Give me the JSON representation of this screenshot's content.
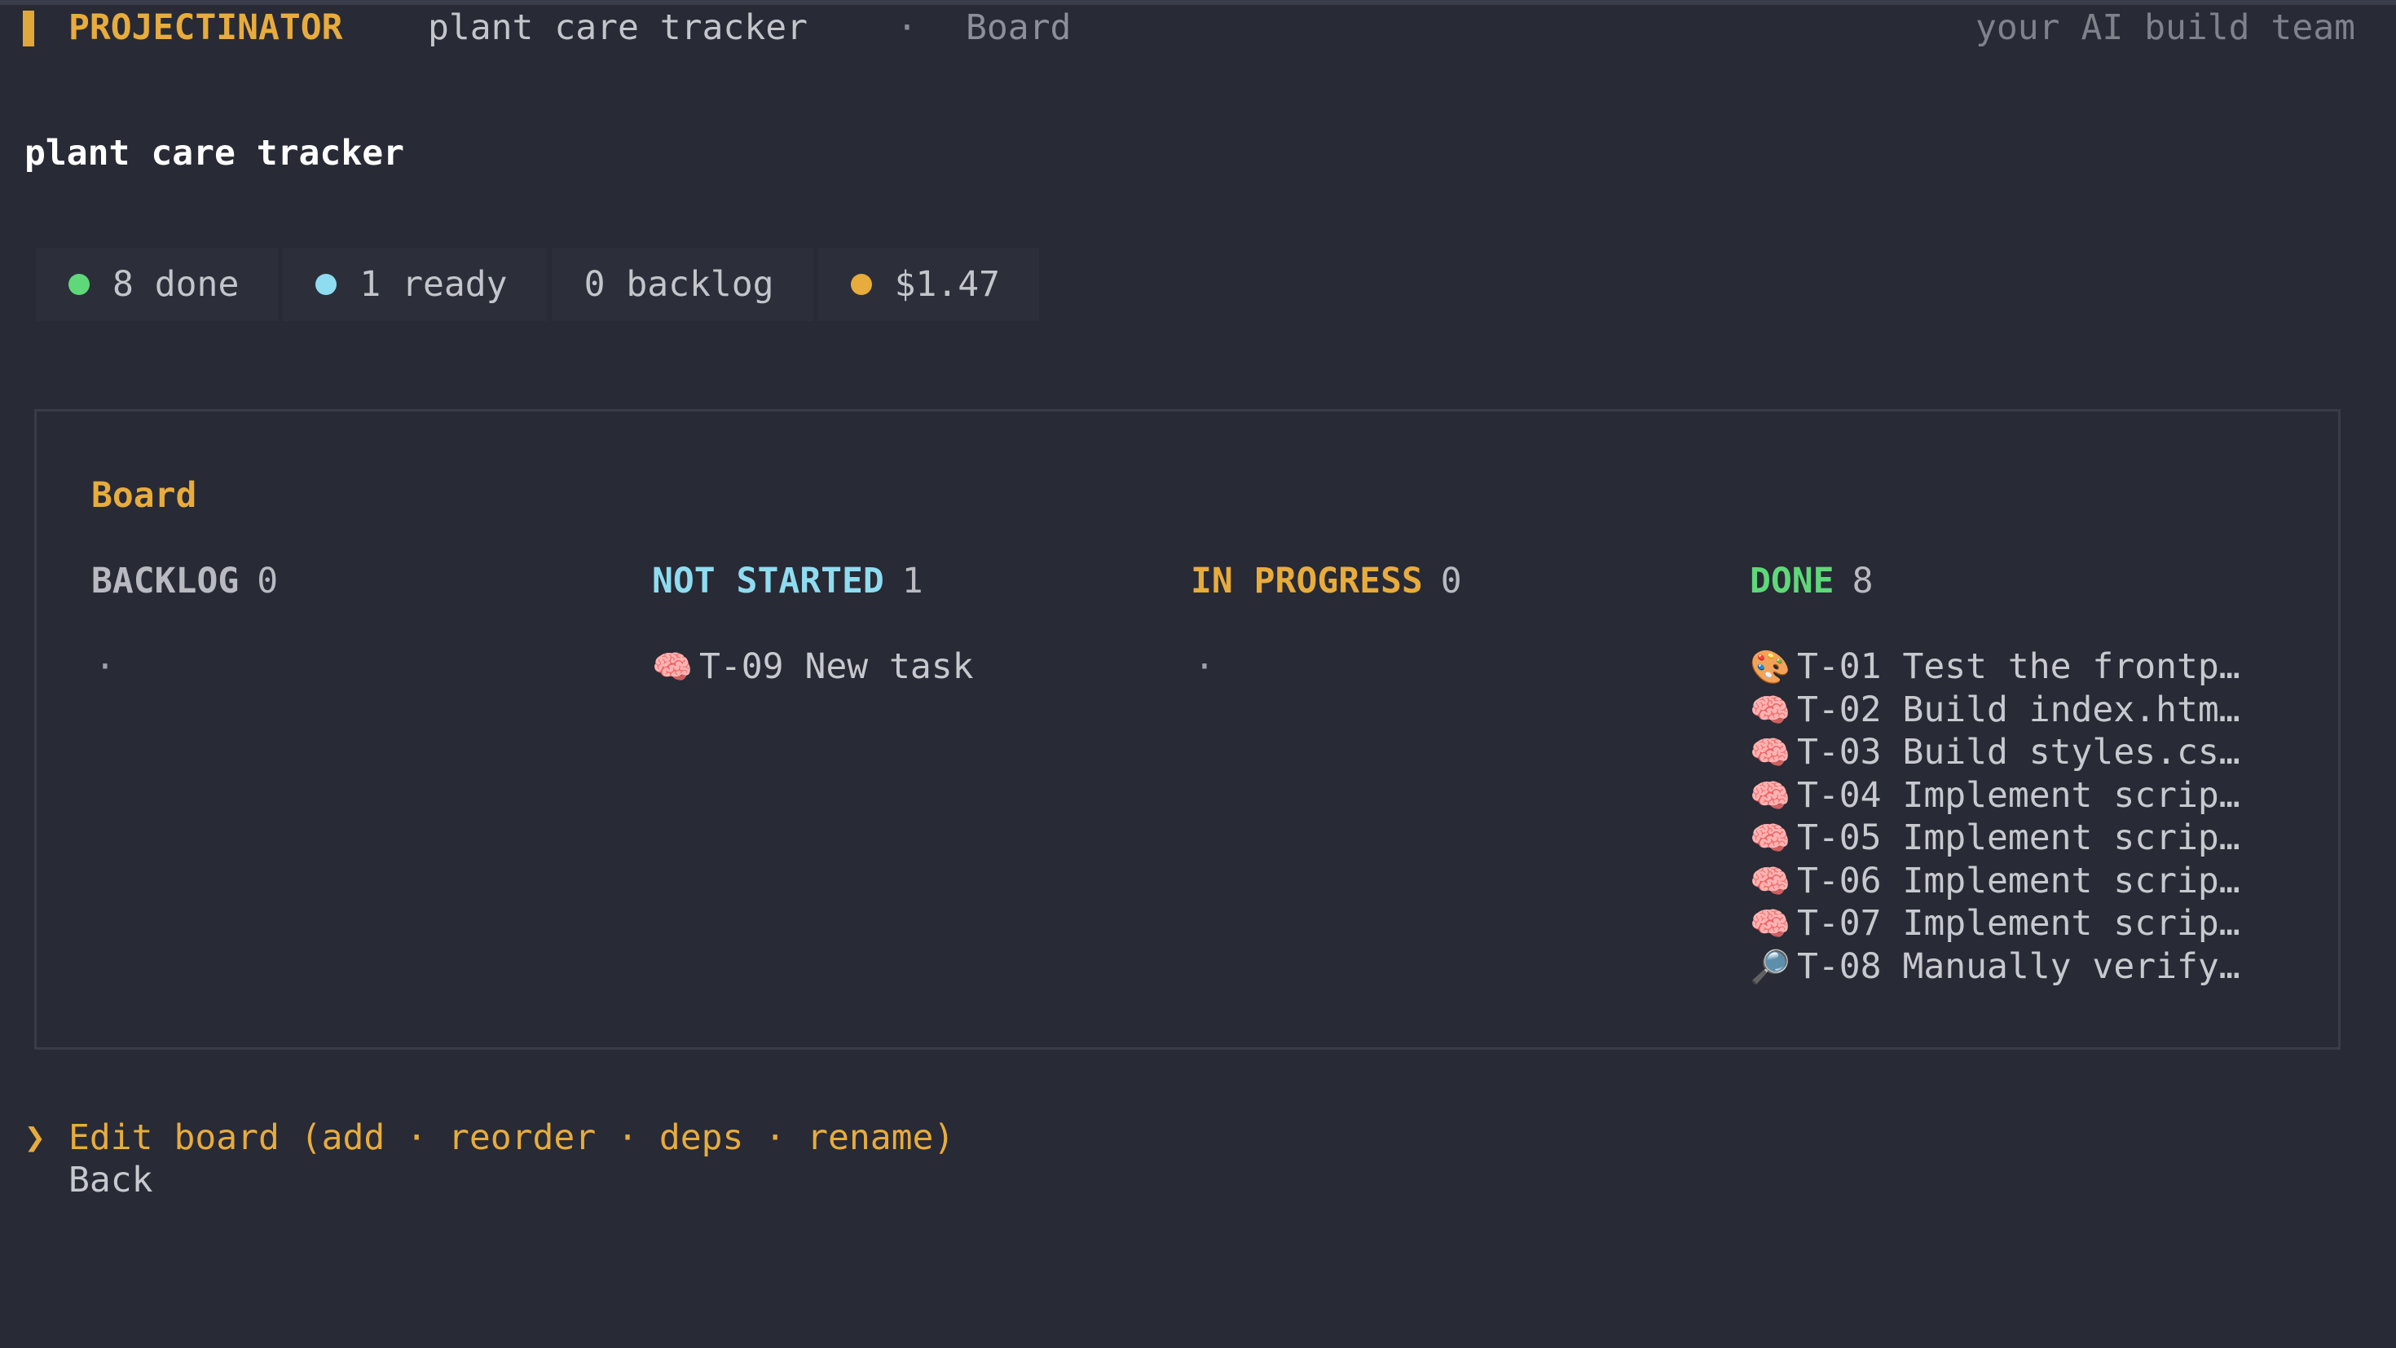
{
  "header": {
    "brand": "PROJECTINATOR",
    "project": "plant care tracker",
    "separator": "·",
    "crumb": "Board",
    "tagline": "your AI build team"
  },
  "page_title": "plant care tracker",
  "stats": [
    {
      "label": "8 done",
      "dot_color": "#5fd87a"
    },
    {
      "label": "1 ready",
      "dot_color": "#8fdcf0"
    },
    {
      "label": "0 backlog",
      "dot_color": ""
    },
    {
      "label": "$1.47",
      "dot_color": "#e8ac3c"
    }
  ],
  "board": {
    "title": "Board",
    "columns": [
      {
        "name": "BACKLOG",
        "count": "0",
        "color": "#b9bac1",
        "empty": "·",
        "items": []
      },
      {
        "name": "NOT STARTED",
        "count": "1",
        "color": "#8fdcf0",
        "empty": "",
        "items": [
          {
            "icon": "🧠",
            "text": "T-09 New task"
          }
        ]
      },
      {
        "name": "IN PROGRESS",
        "count": "0",
        "color": "#e8ac3c",
        "empty": "·",
        "items": []
      },
      {
        "name": "DONE",
        "count": "8",
        "color": "#5fd87a",
        "empty": "",
        "items": [
          {
            "icon": "🎨",
            "text": "T-01 Test the frontp…"
          },
          {
            "icon": "🧠",
            "text": "T-02 Build index.htm…"
          },
          {
            "icon": "🧠",
            "text": "T-03 Build styles.cs…"
          },
          {
            "icon": "🧠",
            "text": "T-04 Implement scrip…"
          },
          {
            "icon": "🧠",
            "text": "T-05 Implement scrip…"
          },
          {
            "icon": "🧠",
            "text": "T-06 Implement scrip…"
          },
          {
            "icon": "🧠",
            "text": "T-07 Implement scrip…"
          },
          {
            "icon": "🔎",
            "text": "T-08 Manually verify…"
          }
        ]
      }
    ]
  },
  "menu": {
    "caret": "❯",
    "items": [
      {
        "label": "Edit board (add · reorder · deps · rename)",
        "selected": true
      },
      {
        "label": "Back",
        "selected": false
      }
    ]
  }
}
